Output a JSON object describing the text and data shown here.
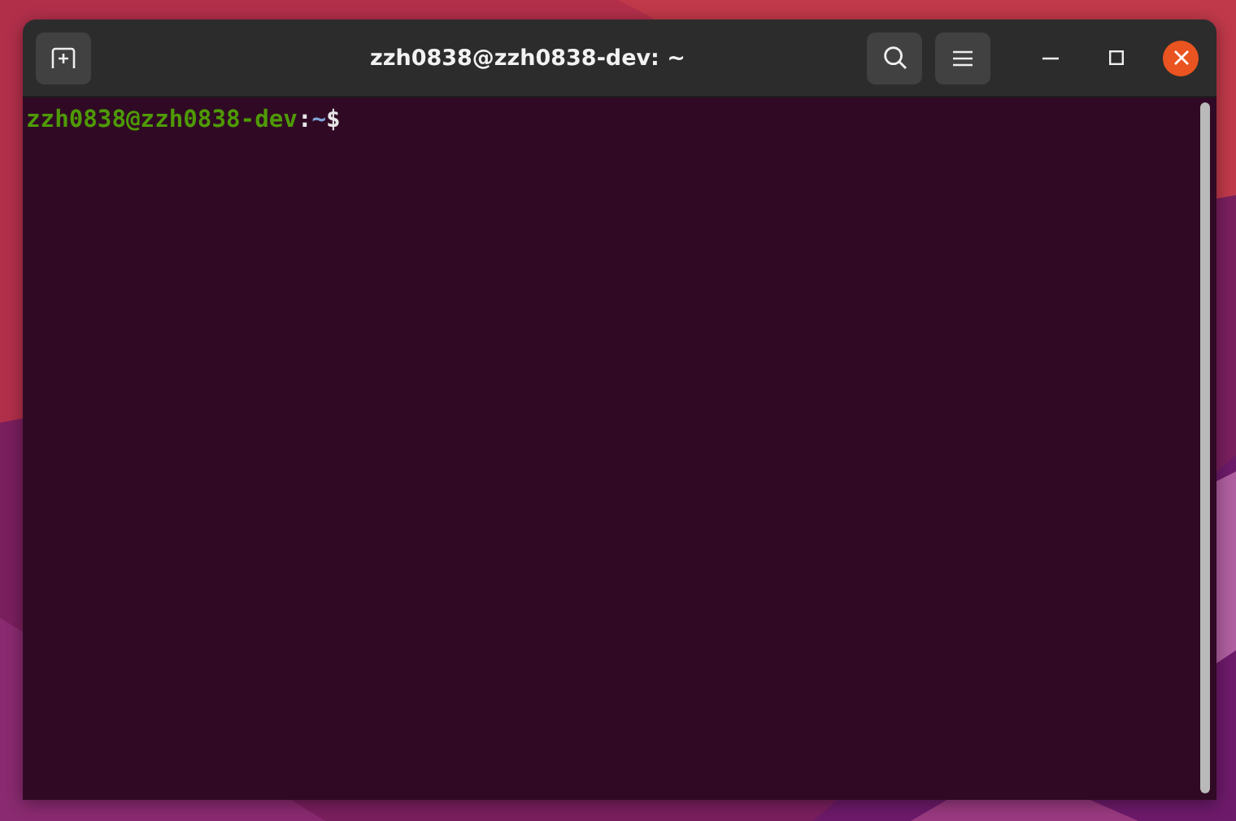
{
  "window": {
    "title": "zzh0838@zzh0838-dev: ~"
  },
  "terminal": {
    "prompt": {
      "user_host": "zzh0838@zzh0838-dev",
      "separator": ":",
      "path": "~",
      "symbol": "$"
    }
  }
}
